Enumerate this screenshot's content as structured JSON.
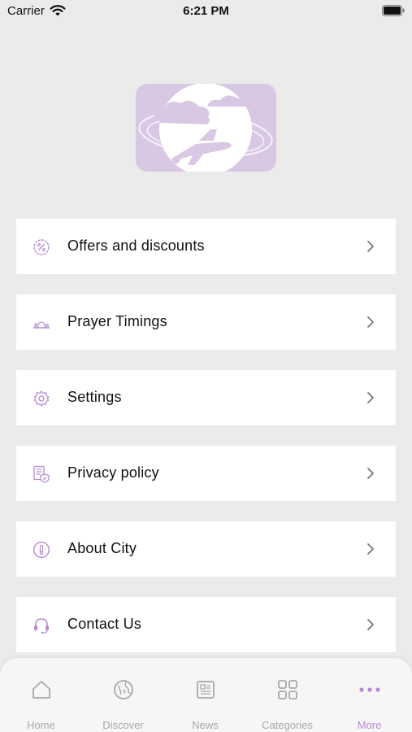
{
  "status_bar": {
    "carrier": "Carrier",
    "time": "6:21 PM"
  },
  "colors": {
    "accent": "#b78bd1",
    "background": "#ebebeb",
    "card": "#ffffff",
    "inactive": "#a9a9a9"
  },
  "menu": {
    "items": [
      {
        "label": "Offers and discounts",
        "icon": "percent-badge-icon"
      },
      {
        "label": "Prayer Timings",
        "icon": "mosque-icon"
      },
      {
        "label": "Settings",
        "icon": "gear-icon"
      },
      {
        "label": "Privacy policy",
        "icon": "privacy-document-icon"
      },
      {
        "label": "About City",
        "icon": "info-icon"
      },
      {
        "label": "Contact Us",
        "icon": "headset-icon"
      }
    ]
  },
  "tab_bar": {
    "tabs": [
      {
        "label": "Home",
        "icon": "home-icon",
        "active": false
      },
      {
        "label": "Discover",
        "icon": "globe-icon",
        "active": false
      },
      {
        "label": "News",
        "icon": "newspaper-icon",
        "active": false
      },
      {
        "label": "Categories",
        "icon": "grid-icon",
        "active": false
      },
      {
        "label": "More",
        "icon": "more-dots-icon",
        "active": true
      }
    ]
  }
}
